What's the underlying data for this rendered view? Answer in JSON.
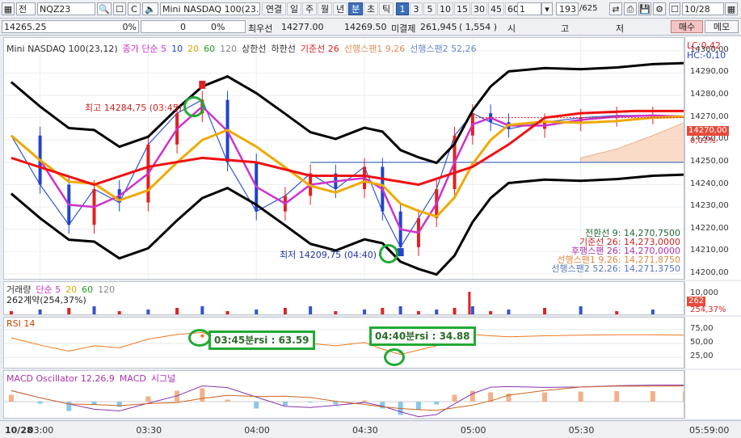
{
  "toolbar": {
    "gubun": "전",
    "symbol": "NQZ23",
    "search_icon": "search-icon",
    "name": "Mini NASDAQ 100(23.1",
    "tabs": [
      {
        "label": "연결",
        "active": false
      },
      {
        "label": "일",
        "active": false
      },
      {
        "label": "주",
        "active": false
      },
      {
        "label": "월",
        "active": false
      },
      {
        "label": "년",
        "active": false
      },
      {
        "label": "분",
        "active": true
      },
      {
        "label": "초",
        "active": false
      },
      {
        "label": "틱",
        "active": false
      }
    ],
    "intervals": [
      {
        "label": "1",
        "active": true
      },
      {
        "label": "3",
        "active": false
      },
      {
        "label": "5",
        "active": false
      },
      {
        "label": "10",
        "active": false
      },
      {
        "label": "15",
        "active": false
      },
      {
        "label": "30",
        "active": false
      },
      {
        "label": "45",
        "active": false
      },
      {
        "label": "60",
        "active": false
      }
    ],
    "period": "1",
    "count": "193",
    "count_total": "/625",
    "date": "10/28"
  },
  "quote": {
    "price": "14265.25",
    "change_pct": "0%",
    "change_amt": "0",
    "change_pct2": "0%",
    "best_ask_label": "최우선",
    "best_ask": "14277.00",
    "best_bid": "14269.50",
    "open_int_label": "미결제",
    "open_int": "261,945",
    "open_int_chg": "( 1,554 )",
    "hl_label": "시",
    "high_label": "고",
    "low_label": "저",
    "buy_label": "매수",
    "memo_label": "메모"
  },
  "price_panel": {
    "legend": [
      {
        "text": "Mini NASDAQ 100(23,12)",
        "color": "#333333"
      },
      {
        "text": "종가 단순 5",
        "color": "#cc33cc"
      },
      {
        "text": "10",
        "color": "#2244cc"
      },
      {
        "text": "20",
        "color": "#ddaa00"
      },
      {
        "text": "60",
        "color": "#229922"
      },
      {
        "text": "120",
        "color": "#888888"
      },
      {
        "text": "상한선",
        "color": "#333333"
      },
      {
        "text": "하한선",
        "color": "#333333"
      },
      {
        "text": "기준선 26",
        "color": "#dd2222"
      },
      {
        "text": "선행스팬1 9,26",
        "color": "#e0905a"
      },
      {
        "text": "선행스팬2 52,26",
        "color": "#6688cc"
      }
    ],
    "lc": "LC:0,42",
    "hc": "HC:-0,10",
    "y_ticks": [
      "14300,00",
      "14290,00",
      "14280,00",
      "14270,00",
      "14260,00",
      "14250,00",
      "14240,00",
      "14230,00",
      "14220,00",
      "14210,00",
      "14200,00"
    ],
    "current_tag": "14270,00",
    "current_pct": "0,01%",
    "high_label": "최고 14284,75 (03:45)",
    "low_label": "최저 14209,75 (04:40)",
    "stats": [
      {
        "text": "전환선 9: 14,270,7500",
        "color": "#226633"
      },
      {
        "text": "기준선 26: 14,273,0000",
        "color": "#cc2222"
      },
      {
        "text": "후행스팬 26: 14,270,0000",
        "color": "#aa33aa"
      },
      {
        "text": "선행스팬1 9,26: 14,271,8750",
        "color": "#dd8844"
      },
      {
        "text": "선행스팬2 52,26: 14,271,3750",
        "color": "#5577bb"
      }
    ]
  },
  "volume_panel": {
    "legend": [
      {
        "text": "거래량",
        "color": "#333333"
      },
      {
        "text": "단순 5",
        "color": "#cc33cc"
      },
      {
        "text": "20",
        "color": "#ddaa00"
      },
      {
        "text": "60",
        "color": "#229922"
      },
      {
        "text": "120",
        "color": "#888888"
      }
    ],
    "contracts": "262계약(254,37%)",
    "y_tick": "10,000",
    "tag_value": "262",
    "tag_pct": "254,37%"
  },
  "rsi_panel": {
    "legend": "RSI 14",
    "y_ticks": [
      "75,00",
      "50,00",
      "25,00"
    ],
    "annotation1": "03:45분rsi : 63.59",
    "annotation2": "04:40분rsi : 34.88"
  },
  "macd_panel": {
    "legend": [
      {
        "text": "MACD Oscillator 12,26,9",
        "color": "#aa33aa"
      },
      {
        "text": "MACD",
        "color": "#aa33aa"
      },
      {
        "text": "시그널",
        "color": "#aa33aa"
      }
    ]
  },
  "x_axis": {
    "date": "10/28",
    "ticks": [
      "03:00",
      "03:30",
      "04:00",
      "04:30",
      "05:00",
      "05:30"
    ],
    "clock": "05:59:00"
  },
  "chart_data": {
    "type": "line",
    "title": "Mini NASDAQ 100(23,12)",
    "x_range": [
      "02:50",
      "05:59"
    ],
    "ylim": [
      14200,
      14305
    ],
    "highest": {
      "value": 14284.75,
      "time": "03:45"
    },
    "lowest": {
      "value": 14209.75,
      "time": "04:40"
    },
    "current": 14270,
    "series": [
      {
        "name": "종가",
        "x": [
          "02:52",
          "03:00",
          "03:08",
          "03:15",
          "03:22",
          "03:30",
          "03:38",
          "03:45",
          "03:52",
          "04:00",
          "04:08",
          "04:15",
          "04:22",
          "04:30",
          "04:35",
          "04:40",
          "04:45",
          "04:50",
          "04:55",
          "05:00",
          "05:05",
          "05:10",
          "05:20",
          "05:30",
          "05:40",
          "05:50",
          "05:59"
        ],
        "values": [
          14262,
          14240,
          14222,
          14238,
          14232,
          14258,
          14272,
          14278,
          14250,
          14228,
          14235,
          14245,
          14238,
          14248,
          14228,
          14212,
          14225,
          14238,
          14262,
          14272,
          14268,
          14265,
          14268,
          14270,
          14271,
          14271,
          14270
        ]
      },
      {
        "name": "기준선 26",
        "x": [
          "02:52",
          "03:15",
          "03:30",
          "03:45",
          "04:00",
          "04:15",
          "04:30",
          "04:45",
          "05:00",
          "05:10",
          "05:20",
          "05:30",
          "05:45",
          "05:59"
        ],
        "values": [
          14252,
          14240,
          14248,
          14252,
          14250,
          14244,
          14244,
          14240,
          14248,
          14258,
          14270,
          14272,
          14273,
          14273
        ]
      }
    ],
    "rsi": {
      "points": [
        {
          "time": "03:45",
          "value": 63.59
        },
        {
          "time": "04:40",
          "value": 34.88
        }
      ]
    }
  }
}
